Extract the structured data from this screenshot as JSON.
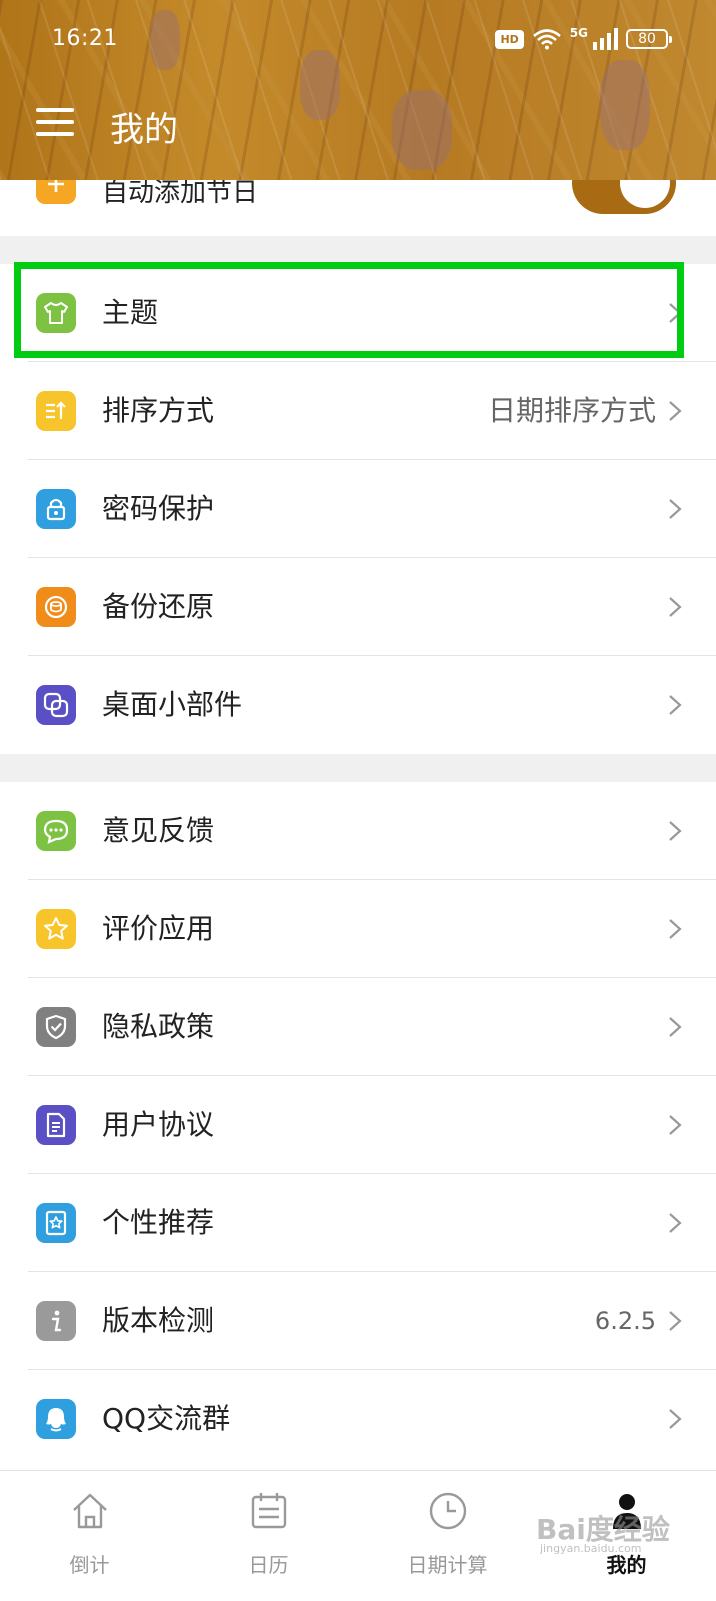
{
  "status_bar": {
    "time": "16:21",
    "hd": "HD",
    "network": "5G",
    "battery": "80"
  },
  "header": {
    "title": "我的",
    "menu_icon": "hamburger-menu-icon"
  },
  "partial_item": {
    "label": "自动添加节日",
    "icon": "plus-icon",
    "icon_color": "#f5a623",
    "toggle_on": true
  },
  "group1": [
    {
      "label": "主题",
      "icon": "tshirt-icon",
      "color": "#7dc243",
      "value": "",
      "highlighted": true
    },
    {
      "label": "排序方式",
      "icon": "sort-icon",
      "color": "#f7c52b",
      "value": "日期排序方式"
    },
    {
      "label": "密码保护",
      "icon": "lock-icon",
      "color": "#2f9fe0",
      "value": ""
    },
    {
      "label": "备份还原",
      "icon": "backup-icon",
      "color": "#f08c1a",
      "value": ""
    },
    {
      "label": "桌面小部件",
      "icon": "widget-icon",
      "color": "#5a4fc4",
      "value": ""
    }
  ],
  "group2": [
    {
      "label": "意见反馈",
      "icon": "chat-icon",
      "color": "#7dc243",
      "value": ""
    },
    {
      "label": "评价应用",
      "icon": "star-icon",
      "color": "#f7c52b",
      "value": ""
    },
    {
      "label": "隐私政策",
      "icon": "shield-icon",
      "color": "#808080",
      "value": ""
    },
    {
      "label": "用户协议",
      "icon": "document-icon",
      "color": "#5a4fc4",
      "value": ""
    },
    {
      "label": "个性推荐",
      "icon": "badge-icon",
      "color": "#2f9fe0",
      "value": ""
    },
    {
      "label": "版本检测",
      "icon": "info-icon",
      "color": "#9a9a9a",
      "value": "6.2.5"
    },
    {
      "label": "QQ交流群",
      "icon": "qq-icon",
      "color": "#2f9fe0",
      "value": ""
    }
  ],
  "tabs": [
    {
      "label": "倒计",
      "icon": "home-icon",
      "active": false
    },
    {
      "label": "日历",
      "icon": "calendar-icon",
      "active": false
    },
    {
      "label": "日期计算",
      "icon": "clock-icon",
      "active": false
    },
    {
      "label": "我的",
      "icon": "profile-icon",
      "active": true
    }
  ],
  "watermark": {
    "text": "Bai度经验",
    "sub": "jingyan.baidu.com"
  }
}
